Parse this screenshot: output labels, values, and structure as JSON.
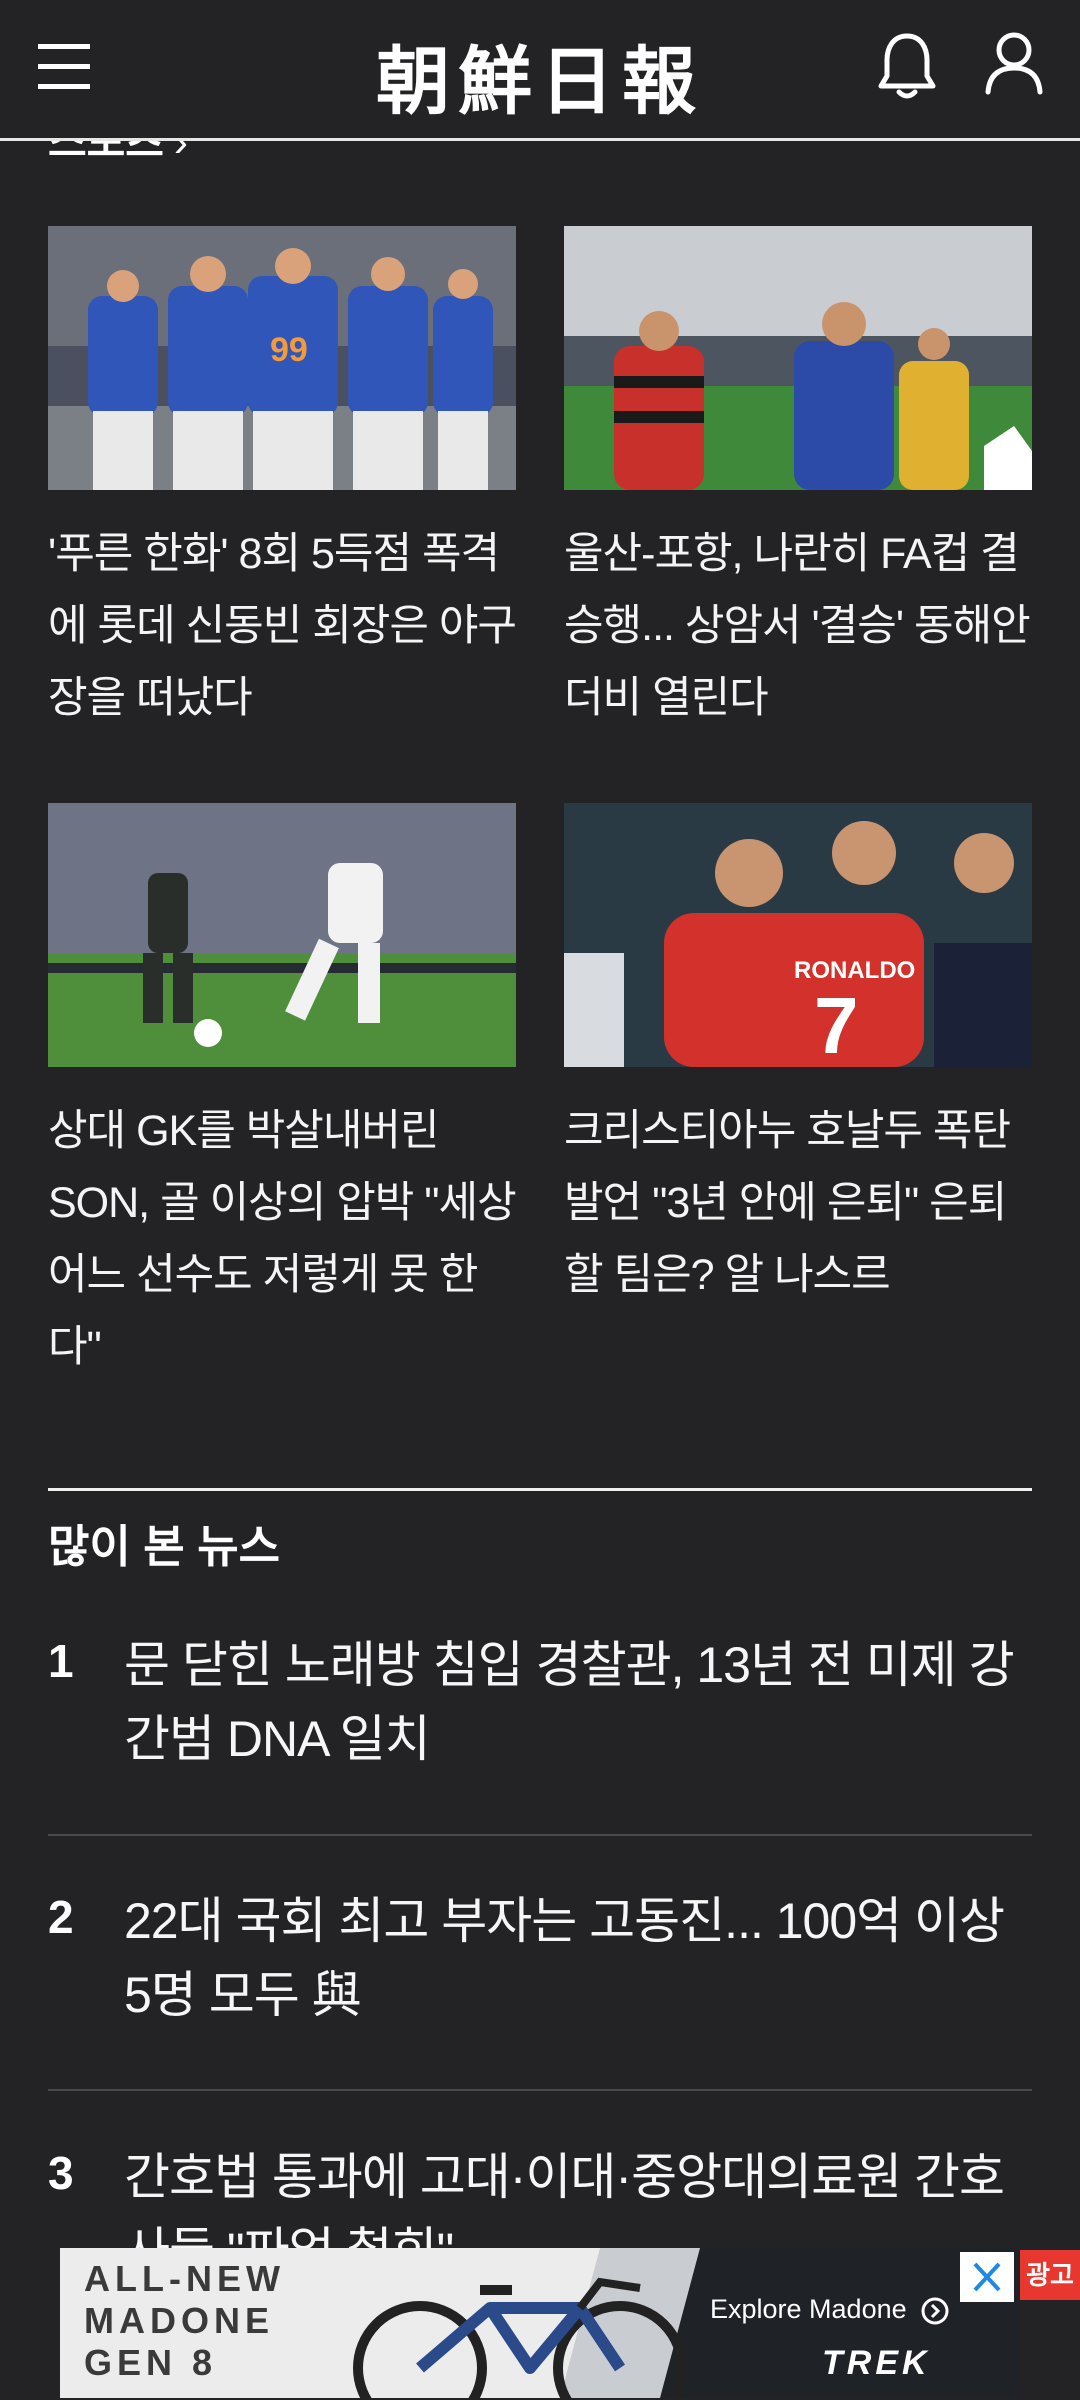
{
  "header": {
    "logo_text": "朝鮮日報",
    "menu_icon": "hamburger-menu-icon",
    "bell_icon": "bell-icon",
    "user_icon": "user-icon"
  },
  "sports_section": {
    "title_partial": "스포츠",
    "chevron": "›",
    "articles": [
      {
        "title": "'푸른 한화' 8회 5득점 폭격에 롯데 신동빈 회장은 야구장을 떠났다"
      },
      {
        "title": "울산-포항, 나란히 FA컵 결승행... 상암서 '결승' 동해안 더비 열린다"
      },
      {
        "title": "상대 GK를 박살내버린 SON, 골 이상의 압박 \"세상 어느 선수도 저렇게 못 한다\""
      },
      {
        "title": "크리스티아누 호날두 폭탄발언 \"3년 안에 은퇴\" 은퇴할 팀은? 알 나스르"
      }
    ]
  },
  "popular": {
    "title": "많이 본 뉴스",
    "items": [
      {
        "rank": "1",
        "title": "문 닫힌 노래방 침입 경찰관, 13년 전 미제 강간범 DNA 일치"
      },
      {
        "rank": "2",
        "title": "22대 국회 최고 부자는 고동진... 100억 이상 5명 모두 與"
      },
      {
        "rank": "3",
        "title": "간호법 통과에 고대·이대·중앙대의료원 간호사들 \"파업 철회\""
      }
    ]
  },
  "ad": {
    "headline": [
      "ALL-NEW",
      "MADONE",
      "GEN 8"
    ],
    "cta": "Explore Madone",
    "brand": "TREK",
    "badge": "광고",
    "info_icon": "info-icon",
    "close_icon": "close-icon"
  },
  "colors": {
    "background": "#232325",
    "text": "#f2f2f2",
    "ad_badge": "#e8372f"
  }
}
